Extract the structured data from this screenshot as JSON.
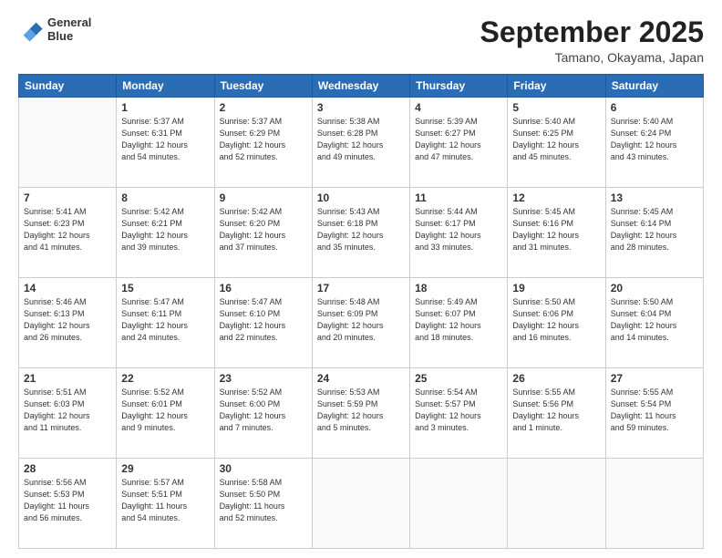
{
  "header": {
    "logo_line1": "General",
    "logo_line2": "Blue",
    "month": "September 2025",
    "location": "Tamano, Okayama, Japan"
  },
  "weekdays": [
    "Sunday",
    "Monday",
    "Tuesday",
    "Wednesday",
    "Thursday",
    "Friday",
    "Saturday"
  ],
  "weeks": [
    [
      {
        "day": "",
        "info": ""
      },
      {
        "day": "1",
        "info": "Sunrise: 5:37 AM\nSunset: 6:31 PM\nDaylight: 12 hours\nand 54 minutes."
      },
      {
        "day": "2",
        "info": "Sunrise: 5:37 AM\nSunset: 6:29 PM\nDaylight: 12 hours\nand 52 minutes."
      },
      {
        "day": "3",
        "info": "Sunrise: 5:38 AM\nSunset: 6:28 PM\nDaylight: 12 hours\nand 49 minutes."
      },
      {
        "day": "4",
        "info": "Sunrise: 5:39 AM\nSunset: 6:27 PM\nDaylight: 12 hours\nand 47 minutes."
      },
      {
        "day": "5",
        "info": "Sunrise: 5:40 AM\nSunset: 6:25 PM\nDaylight: 12 hours\nand 45 minutes."
      },
      {
        "day": "6",
        "info": "Sunrise: 5:40 AM\nSunset: 6:24 PM\nDaylight: 12 hours\nand 43 minutes."
      }
    ],
    [
      {
        "day": "7",
        "info": "Sunrise: 5:41 AM\nSunset: 6:23 PM\nDaylight: 12 hours\nand 41 minutes."
      },
      {
        "day": "8",
        "info": "Sunrise: 5:42 AM\nSunset: 6:21 PM\nDaylight: 12 hours\nand 39 minutes."
      },
      {
        "day": "9",
        "info": "Sunrise: 5:42 AM\nSunset: 6:20 PM\nDaylight: 12 hours\nand 37 minutes."
      },
      {
        "day": "10",
        "info": "Sunrise: 5:43 AM\nSunset: 6:18 PM\nDaylight: 12 hours\nand 35 minutes."
      },
      {
        "day": "11",
        "info": "Sunrise: 5:44 AM\nSunset: 6:17 PM\nDaylight: 12 hours\nand 33 minutes."
      },
      {
        "day": "12",
        "info": "Sunrise: 5:45 AM\nSunset: 6:16 PM\nDaylight: 12 hours\nand 31 minutes."
      },
      {
        "day": "13",
        "info": "Sunrise: 5:45 AM\nSunset: 6:14 PM\nDaylight: 12 hours\nand 28 minutes."
      }
    ],
    [
      {
        "day": "14",
        "info": "Sunrise: 5:46 AM\nSunset: 6:13 PM\nDaylight: 12 hours\nand 26 minutes."
      },
      {
        "day": "15",
        "info": "Sunrise: 5:47 AM\nSunset: 6:11 PM\nDaylight: 12 hours\nand 24 minutes."
      },
      {
        "day": "16",
        "info": "Sunrise: 5:47 AM\nSunset: 6:10 PM\nDaylight: 12 hours\nand 22 minutes."
      },
      {
        "day": "17",
        "info": "Sunrise: 5:48 AM\nSunset: 6:09 PM\nDaylight: 12 hours\nand 20 minutes."
      },
      {
        "day": "18",
        "info": "Sunrise: 5:49 AM\nSunset: 6:07 PM\nDaylight: 12 hours\nand 18 minutes."
      },
      {
        "day": "19",
        "info": "Sunrise: 5:50 AM\nSunset: 6:06 PM\nDaylight: 12 hours\nand 16 minutes."
      },
      {
        "day": "20",
        "info": "Sunrise: 5:50 AM\nSunset: 6:04 PM\nDaylight: 12 hours\nand 14 minutes."
      }
    ],
    [
      {
        "day": "21",
        "info": "Sunrise: 5:51 AM\nSunset: 6:03 PM\nDaylight: 12 hours\nand 11 minutes."
      },
      {
        "day": "22",
        "info": "Sunrise: 5:52 AM\nSunset: 6:01 PM\nDaylight: 12 hours\nand 9 minutes."
      },
      {
        "day": "23",
        "info": "Sunrise: 5:52 AM\nSunset: 6:00 PM\nDaylight: 12 hours\nand 7 minutes."
      },
      {
        "day": "24",
        "info": "Sunrise: 5:53 AM\nSunset: 5:59 PM\nDaylight: 12 hours\nand 5 minutes."
      },
      {
        "day": "25",
        "info": "Sunrise: 5:54 AM\nSunset: 5:57 PM\nDaylight: 12 hours\nand 3 minutes."
      },
      {
        "day": "26",
        "info": "Sunrise: 5:55 AM\nSunset: 5:56 PM\nDaylight: 12 hours\nand 1 minute."
      },
      {
        "day": "27",
        "info": "Sunrise: 5:55 AM\nSunset: 5:54 PM\nDaylight: 11 hours\nand 59 minutes."
      }
    ],
    [
      {
        "day": "28",
        "info": "Sunrise: 5:56 AM\nSunset: 5:53 PM\nDaylight: 11 hours\nand 56 minutes."
      },
      {
        "day": "29",
        "info": "Sunrise: 5:57 AM\nSunset: 5:51 PM\nDaylight: 11 hours\nand 54 minutes."
      },
      {
        "day": "30",
        "info": "Sunrise: 5:58 AM\nSunset: 5:50 PM\nDaylight: 11 hours\nand 52 minutes."
      },
      {
        "day": "",
        "info": ""
      },
      {
        "day": "",
        "info": ""
      },
      {
        "day": "",
        "info": ""
      },
      {
        "day": "",
        "info": ""
      }
    ]
  ]
}
